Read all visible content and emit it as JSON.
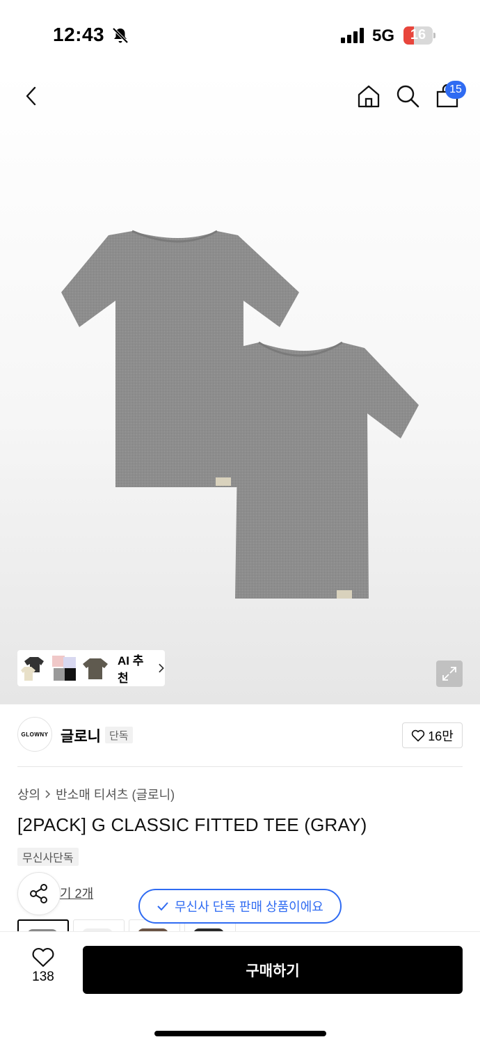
{
  "status_bar": {
    "time": "12:43",
    "network": "5G",
    "battery": "16",
    "battery_level": 0.16,
    "battery_color": "#e8453c"
  },
  "top_nav": {
    "icons": [
      "back-icon",
      "home-icon",
      "search-icon",
      "cart-icon"
    ],
    "cart_count": "15",
    "badge_color": "#2f6bf2"
  },
  "gallery": {
    "image": "two-gray-tshirts",
    "ai_label": "AI 추천"
  },
  "brand": {
    "logo_text": "GLOWNY",
    "name": "글로니",
    "tag": "단독",
    "likes": "16만"
  },
  "product": {
    "breadcrumb": [
      "상의",
      "반소매 티셔츠 (글로니)"
    ],
    "title": "[2PACK] G CLASSIC FITTED TEE (GRAY)",
    "exclusive_tag": "무신사단독",
    "other_colors": "기 2개",
    "thumbnail_colors": [
      "#8a8a8a",
      "#efefef",
      "#6a5445",
      "#2a2a2a"
    ]
  },
  "toast": {
    "text": "무신사 단독 판매 상품이에요"
  },
  "bottom_bar": {
    "heart_count": "138",
    "buy_label": "구매하기"
  }
}
